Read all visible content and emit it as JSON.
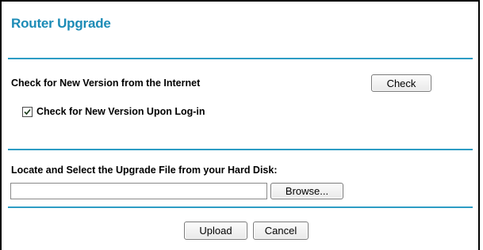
{
  "page": {
    "title": "Router Upgrade",
    "accent_color": "#1b8bb6"
  },
  "internet_check": {
    "label": "Check for New Version from the Internet",
    "check_button": "Check",
    "login_checkbox_label": "Check for New Version Upon Log-in",
    "login_checkbox_checked": true
  },
  "upgrade_file": {
    "label": "Locate and Select the Upgrade File from your Hard Disk:",
    "file_path_value": "",
    "browse_button": "Browse..."
  },
  "actions": {
    "upload_button": "Upload",
    "cancel_button": "Cancel"
  }
}
